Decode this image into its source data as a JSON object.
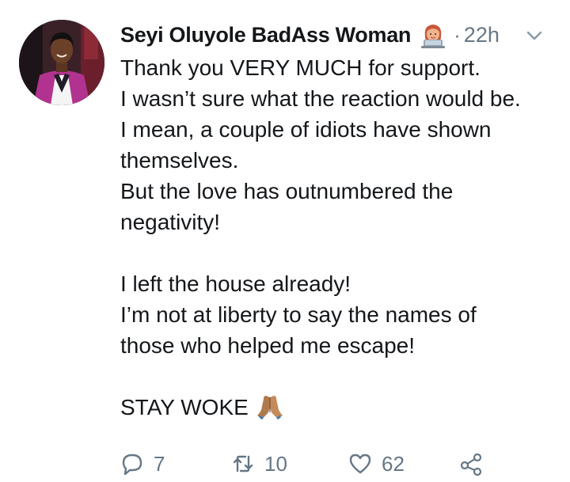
{
  "tweet": {
    "author_name": "Seyi Oluyole BadAss Woman",
    "author_badge_icon": "woman-technologist-emoji",
    "separator": "·",
    "time": "22h",
    "lines": [
      "Thank you VERY MUCH for support.",
      "I wasn’t sure what the reaction would be.",
      "I mean, a couple of idiots have shown",
      "themselves.",
      "But the love has outnumbered the",
      "negativity!",
      "",
      "I left the house already!",
      "I’m not at liberty to say the names of",
      "those who helped me escape!",
      "",
      "STAY WOKE"
    ],
    "trailing_emoji_icon": "folded-hands-emoji",
    "actions": {
      "reply_count": "7",
      "retweet_count": "10",
      "like_count": "62"
    }
  },
  "colors": {
    "text": "#14171a",
    "muted": "#657786",
    "background": "#ffffff"
  }
}
